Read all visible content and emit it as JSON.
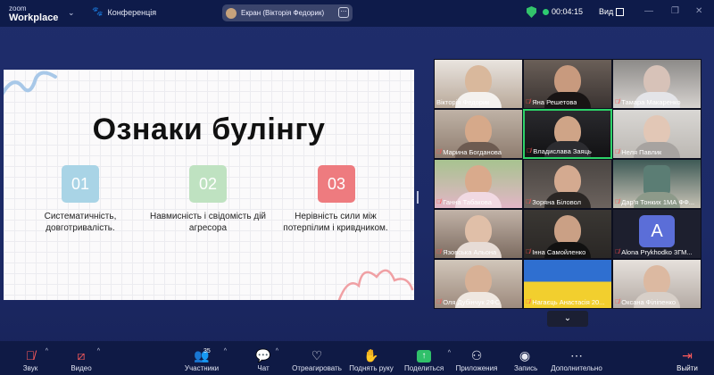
{
  "app": {
    "logo_top": "zoom",
    "logo_bottom": "Workplace",
    "meeting_title": "Конференція"
  },
  "share_pill": {
    "label": "Екран (Вікторія Федорик)"
  },
  "top_right": {
    "timer": "00:04:15",
    "view_label": "Вид"
  },
  "slide": {
    "title": "Ознаки булінгу",
    "points": [
      {
        "num": "01",
        "text": "Систематичність, довготривалість."
      },
      {
        "num": "02",
        "text": "Навмисність і свідомість дій агресора"
      },
      {
        "num": "03",
        "text": "Нерівність сили між потерпілим і кривдником."
      }
    ]
  },
  "participants": [
    {
      "name": "Вікторія Федорик",
      "mic": "on"
    },
    {
      "name": "Яна Решетова",
      "mic": "off"
    },
    {
      "name": "Тамара Макаренко",
      "mic": "off"
    },
    {
      "name": "Марина Богданова",
      "mic": "off"
    },
    {
      "name": "Владислава Заяць",
      "mic": "off"
    },
    {
      "name": "Неля Павлик",
      "mic": "off"
    },
    {
      "name": "Ганна Табакова",
      "mic": "off"
    },
    {
      "name": "Зоряна Біловол",
      "mic": "off"
    },
    {
      "name": "Дар'я Тонких 1МА ФФ...",
      "mic": "off"
    },
    {
      "name": "Язовська Альона",
      "mic": "off"
    },
    {
      "name": "Інна Самойленко",
      "mic": "off"
    },
    {
      "name": "Alona Prykhodko 3ГМ...",
      "mic": "off",
      "avatar": "A"
    },
    {
      "name": "Оля Дубінчук 2ФС",
      "mic": "off"
    },
    {
      "name": "Нагаєць Анастасія 20...",
      "mic": "off"
    },
    {
      "name": "Оксана Філіпенко",
      "mic": "off"
    }
  ],
  "toolbar": {
    "audio": "Звук",
    "video": "Видео",
    "participants": "Участники",
    "participants_count": "35",
    "chat": "Чат",
    "react": "Отреагировать",
    "raise_hand": "Поднять руку",
    "share": "Поделиться",
    "apps": "Приложения",
    "record": "Запись",
    "more": "Дополнительно",
    "leave": "Выйти"
  },
  "colors": {
    "badge1": "#a9d4e6",
    "badge2": "#bfe2c1",
    "badge3": "#ee7b7f",
    "active_speaker": "#2dd268"
  }
}
